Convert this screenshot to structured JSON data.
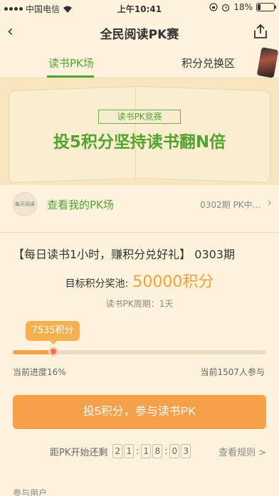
{
  "status": {
    "carrier": "中国电信",
    "time": "上午10:41",
    "battery": "18%"
  },
  "nav": {
    "title": "全民阅读PK赛"
  },
  "tabs": {
    "active": "读书PK场",
    "inactive": "积分兑换区"
  },
  "banner": {
    "badge": "读书PK竞赛",
    "slogan": "投5积分坚持读书翻N倍"
  },
  "mypk": {
    "avatar_text": "每天阅读",
    "link": "查看我的PK场",
    "period": "0302期 PK中..."
  },
  "contest": {
    "headline": "【每日读书1小时，赚积分兑好礼】 0303期",
    "pool_label": "目标积分奖池:",
    "pool_value": "50000积分",
    "cycle": "读书PK周期：1天"
  },
  "progress": {
    "bubble": "7535积分",
    "percent_value": 16,
    "left_text": "当前进度16%",
    "right_text": "当前1507人参与"
  },
  "cta": {
    "label": "投5积分，参与读书PK"
  },
  "countdown": {
    "label": "距PK开始还剩",
    "digits": [
      "2",
      "1",
      "1",
      "8",
      "0",
      "3"
    ],
    "rules": "查看规则 >"
  },
  "footer": {
    "users": "参与用户"
  },
  "colors": {
    "green": "#53a32f",
    "orange": "#f7a04a",
    "bg": "#fdf3dc"
  }
}
